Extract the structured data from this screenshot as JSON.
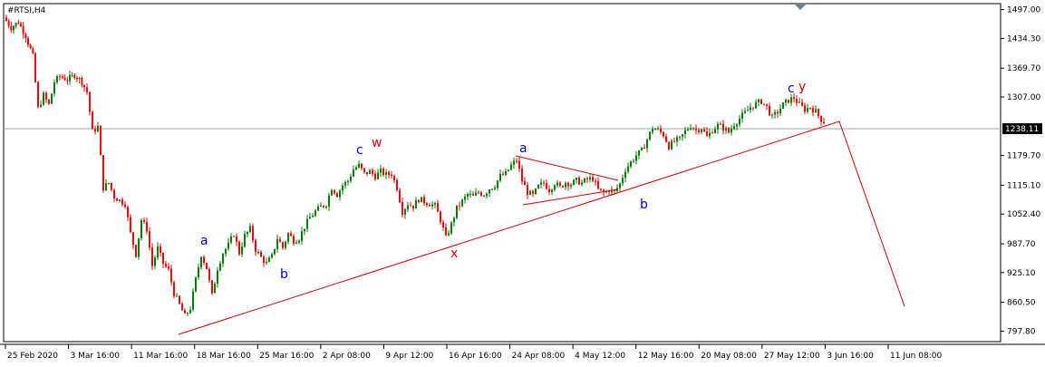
{
  "chart_data": {
    "type": "candlestick",
    "symbol_label": "#RTSI,H4",
    "ylim": [
      775,
      1510
    ],
    "y_ticks": [
      "1497.00",
      "1434.30",
      "1369.70",
      "1307.00",
      "1179.70",
      "1115.10",
      "1052.40",
      "987.70",
      "925.10",
      "860.50",
      "797.80"
    ],
    "current_price": "1238.11",
    "x_tick_labels": [
      "25 Feb 2020",
      "3 Mar 16:00",
      "11 Mar 16:00",
      "18 Mar 16:00",
      "25 Mar 16:00",
      "2 Apr 08:00",
      "9 Apr 12:00",
      "16 Apr 16:00",
      "24 Apr 08:00",
      "4 May 12:00",
      "12 May 16:00",
      "20 May 08:00",
      "27 May 12:00",
      "3 Jun 16:00",
      "11 Jun 08:00"
    ],
    "colors": {
      "up": "#008000",
      "down": "#ff0000",
      "annotation_line": "#e00000",
      "blue_label": "#0000cc",
      "red_label": "#e00000",
      "price_line": "#9aa89a"
    },
    "price_path": [
      [
        0,
        1480
      ],
      [
        8,
        1458
      ],
      [
        16,
        1470
      ],
      [
        24,
        1440
      ],
      [
        32,
        1395
      ],
      [
        38,
        1282
      ],
      [
        44,
        1310
      ],
      [
        50,
        1290
      ],
      [
        56,
        1340
      ],
      [
        62,
        1352
      ],
      [
        70,
        1345
      ],
      [
        78,
        1355
      ],
      [
        86,
        1340
      ],
      [
        92,
        1318
      ],
      [
        98,
        1232
      ],
      [
        104,
        1242
      ],
      [
        110,
        1110
      ],
      [
        116,
        1120
      ],
      [
        122,
        1090
      ],
      [
        128,
        1082
      ],
      [
        134,
        1075
      ],
      [
        140,
        1010
      ],
      [
        146,
        965
      ],
      [
        152,
        1040
      ],
      [
        158,
        1020
      ],
      [
        164,
        940
      ],
      [
        170,
        978
      ],
      [
        176,
        945
      ],
      [
        182,
        930
      ],
      [
        188,
        880
      ],
      [
        194,
        855
      ],
      [
        200,
        830
      ],
      [
        206,
        848
      ],
      [
        212,
        910
      ],
      [
        218,
        965
      ],
      [
        224,
        935
      ],
      [
        230,
        875
      ],
      [
        236,
        935
      ],
      [
        242,
        968
      ],
      [
        248,
        985
      ],
      [
        254,
        1010
      ],
      [
        260,
        968
      ],
      [
        266,
        1005
      ],
      [
        272,
        1020
      ],
      [
        278,
        975
      ],
      [
        284,
        958
      ],
      [
        290,
        945
      ],
      [
        296,
        960
      ],
      [
        302,
        1000
      ],
      [
        308,
        980
      ],
      [
        314,
        1010
      ],
      [
        320,
        995
      ],
      [
        326,
        1000
      ],
      [
        332,
        1025
      ],
      [
        338,
        1045
      ],
      [
        344,
        1058
      ],
      [
        350,
        1068
      ],
      [
        356,
        1075
      ],
      [
        362,
        1110
      ],
      [
        368,
        1095
      ],
      [
        374,
        1115
      ],
      [
        380,
        1125
      ],
      [
        386,
        1150
      ],
      [
        392,
        1158
      ],
      [
        398,
        1140
      ],
      [
        404,
        1145
      ],
      [
        410,
        1135
      ],
      [
        416,
        1145
      ],
      [
        422,
        1138
      ],
      [
        428,
        1140
      ],
      [
        434,
        1110
      ],
      [
        440,
        1058
      ],
      [
        446,
        1075
      ],
      [
        452,
        1070
      ],
      [
        458,
        1085
      ],
      [
        464,
        1080
      ],
      [
        470,
        1075
      ],
      [
        476,
        1070
      ],
      [
        482,
        1040
      ],
      [
        488,
        1000
      ],
      [
        494,
        1030
      ],
      [
        500,
        1065
      ],
      [
        506,
        1080
      ],
      [
        512,
        1095
      ],
      [
        518,
        1090
      ],
      [
        524,
        1100
      ],
      [
        530,
        1095
      ],
      [
        536,
        1108
      ],
      [
        542,
        1115
      ],
      [
        548,
        1135
      ],
      [
        554,
        1140
      ],
      [
        560,
        1158
      ],
      [
        566,
        1170
      ],
      [
        572,
        1125
      ],
      [
        578,
        1100
      ],
      [
        584,
        1092
      ],
      [
        590,
        1112
      ],
      [
        596,
        1120
      ],
      [
        602,
        1105
      ],
      [
        608,
        1120
      ],
      [
        614,
        1110
      ],
      [
        620,
        1122
      ],
      [
        626,
        1118
      ],
      [
        632,
        1125
      ],
      [
        638,
        1120
      ],
      [
        644,
        1128
      ],
      [
        650,
        1130
      ],
      [
        656,
        1105
      ],
      [
        662,
        1098
      ],
      [
        668,
        1105
      ],
      [
        674,
        1100
      ],
      [
        680,
        1118
      ],
      [
        686,
        1150
      ],
      [
        692,
        1165
      ],
      [
        698,
        1180
      ],
      [
        704,
        1190
      ],
      [
        710,
        1215
      ],
      [
        716,
        1240
      ],
      [
        722,
        1235
      ],
      [
        728,
        1225
      ],
      [
        734,
        1200
      ],
      [
        740,
        1210
      ],
      [
        746,
        1215
      ],
      [
        752,
        1232
      ],
      [
        758,
        1245
      ],
      [
        764,
        1235
      ],
      [
        770,
        1240
      ],
      [
        776,
        1220
      ],
      [
        782,
        1235
      ],
      [
        788,
        1245
      ],
      [
        794,
        1240
      ],
      [
        800,
        1230
      ],
      [
        806,
        1248
      ],
      [
        812,
        1260
      ],
      [
        818,
        1272
      ],
      [
        824,
        1285
      ],
      [
        830,
        1292
      ],
      [
        836,
        1298
      ],
      [
        842,
        1285
      ],
      [
        848,
        1262
      ],
      [
        854,
        1275
      ],
      [
        860,
        1290
      ],
      [
        866,
        1300
      ],
      [
        872,
        1305
      ],
      [
        878,
        1290
      ],
      [
        884,
        1280
      ],
      [
        890,
        1285
      ],
      [
        896,
        1275
      ],
      [
        902,
        1258
      ],
      [
        908,
        1248
      ]
    ],
    "annotations": {
      "lines": [
        [
          [
            197,
            369
          ],
          [
            926,
            134
          ],
          [
            998,
            338
          ]
        ],
        [
          [
            569,
            172
          ],
          [
            682,
            199
          ]
        ],
        [
          [
            577,
            226
          ],
          [
            682,
            209
          ]
        ]
      ],
      "labels": [
        {
          "text": "a",
          "x": 221,
          "y": 270,
          "color": "blue"
        },
        {
          "text": "b",
          "x": 309,
          "y": 307,
          "color": "blue"
        },
        {
          "text": "c",
          "x": 393,
          "y": 170,
          "color": "blue"
        },
        {
          "text": "w",
          "x": 410,
          "y": 162,
          "color": "red"
        },
        {
          "text": "x",
          "x": 497,
          "y": 284,
          "color": "red"
        },
        {
          "text": "a",
          "x": 573,
          "y": 168,
          "color": "blue"
        },
        {
          "text": "b",
          "x": 706,
          "y": 230,
          "color": "blue"
        },
        {
          "text": "c",
          "x": 869,
          "y": 102,
          "color": "blue"
        },
        {
          "text": "y",
          "x": 881,
          "y": 100,
          "color": "red"
        }
      ]
    }
  }
}
